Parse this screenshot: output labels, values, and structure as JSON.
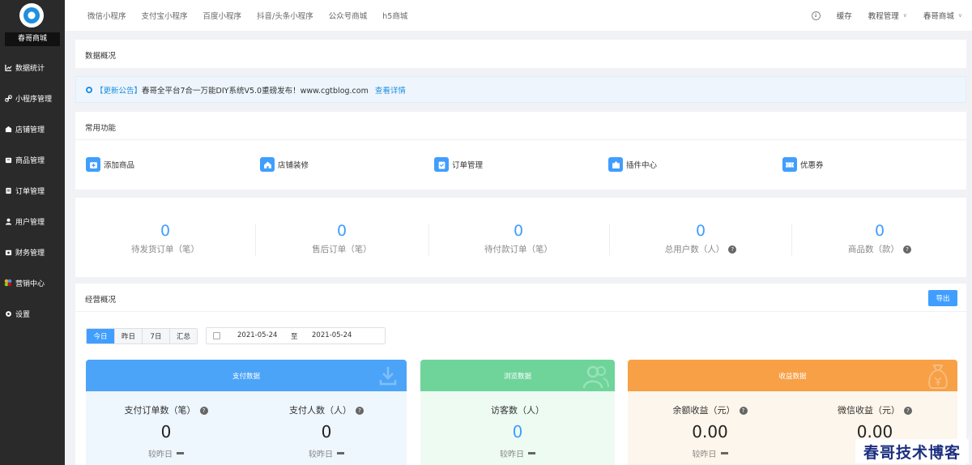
{
  "sidebar": {
    "shop_name": "春哥商城",
    "items": [
      {
        "label": "数据统计",
        "icon": "chart-line-icon"
      },
      {
        "label": "小程序管理",
        "icon": "link-icon"
      },
      {
        "label": "店铺管理",
        "icon": "store-icon"
      },
      {
        "label": "商品管理",
        "icon": "goods-icon"
      },
      {
        "label": "订单管理",
        "icon": "order-icon"
      },
      {
        "label": "用户管理",
        "icon": "user-icon"
      },
      {
        "label": "财务管理",
        "icon": "finance-icon"
      },
      {
        "label": "营销中心",
        "icon": "marketing-icon"
      },
      {
        "label": "设置",
        "icon": "gear-icon"
      }
    ]
  },
  "topbar": {
    "tabs": [
      "微信小程序",
      "支付宝小程序",
      "百度小程序",
      "抖音/头条小程序",
      "公众号商城",
      "h5商城"
    ],
    "cache": "缓存",
    "tutorial": "教程管理",
    "shop": "春哥商城"
  },
  "overview_title": "数据概况",
  "notice": {
    "tag": "【更新公告】",
    "text": "春哥全平台7合一万能DIY系统V5.0重磅发布！www.cgtblog.com",
    "link": "查看详情"
  },
  "quick": {
    "title": "常用功能",
    "items": [
      {
        "label": "添加商品",
        "icon": "add-goods-icon"
      },
      {
        "label": "店铺装修",
        "icon": "home-icon"
      },
      {
        "label": "订单管理",
        "icon": "clipboard-icon"
      },
      {
        "label": "插件中心",
        "icon": "puzzle-icon"
      },
      {
        "label": "优惠券",
        "icon": "coupon-icon"
      }
    ]
  },
  "stats": [
    {
      "value": "0",
      "label": "待发货订单（笔）"
    },
    {
      "value": "0",
      "label": "售后订单（笔）"
    },
    {
      "value": "0",
      "label": "待付款订单（笔）"
    },
    {
      "value": "0",
      "label": "总用户数（人）"
    },
    {
      "value": "0",
      "label": "商品数（款）"
    }
  ],
  "business": {
    "title": "经营概况",
    "export": "导出",
    "ranges": [
      "今日",
      "昨日",
      "7日",
      "汇总"
    ],
    "active_range": "今日",
    "date_from": "2021-05-24",
    "date_sep": "至",
    "date_to": "2021-05-24"
  },
  "compare_label": "较昨日",
  "panels": {
    "pay": {
      "title": "支付数据",
      "color": "#4ca4f8",
      "body": "#eef6fe",
      "cols": [
        {
          "label": "支付订单数（笔）",
          "value": "0"
        },
        {
          "label": "支付人数（人）",
          "value": "0"
        }
      ]
    },
    "visit": {
      "title": "浏览数据",
      "color": "#6fd49a",
      "body": "#eefbf3",
      "cols": [
        {
          "label": "访客数（人）",
          "value": "0"
        }
      ]
    },
    "income": {
      "title": "收益数据",
      "color": "#f7a046",
      "body": "#fdf6ec",
      "cols": [
        {
          "label": "余额收益（元）",
          "value": "0.00"
        },
        {
          "label": "微信收益（元）",
          "value": "0.00"
        }
      ]
    }
  },
  "watermark": "春哥技术博客"
}
